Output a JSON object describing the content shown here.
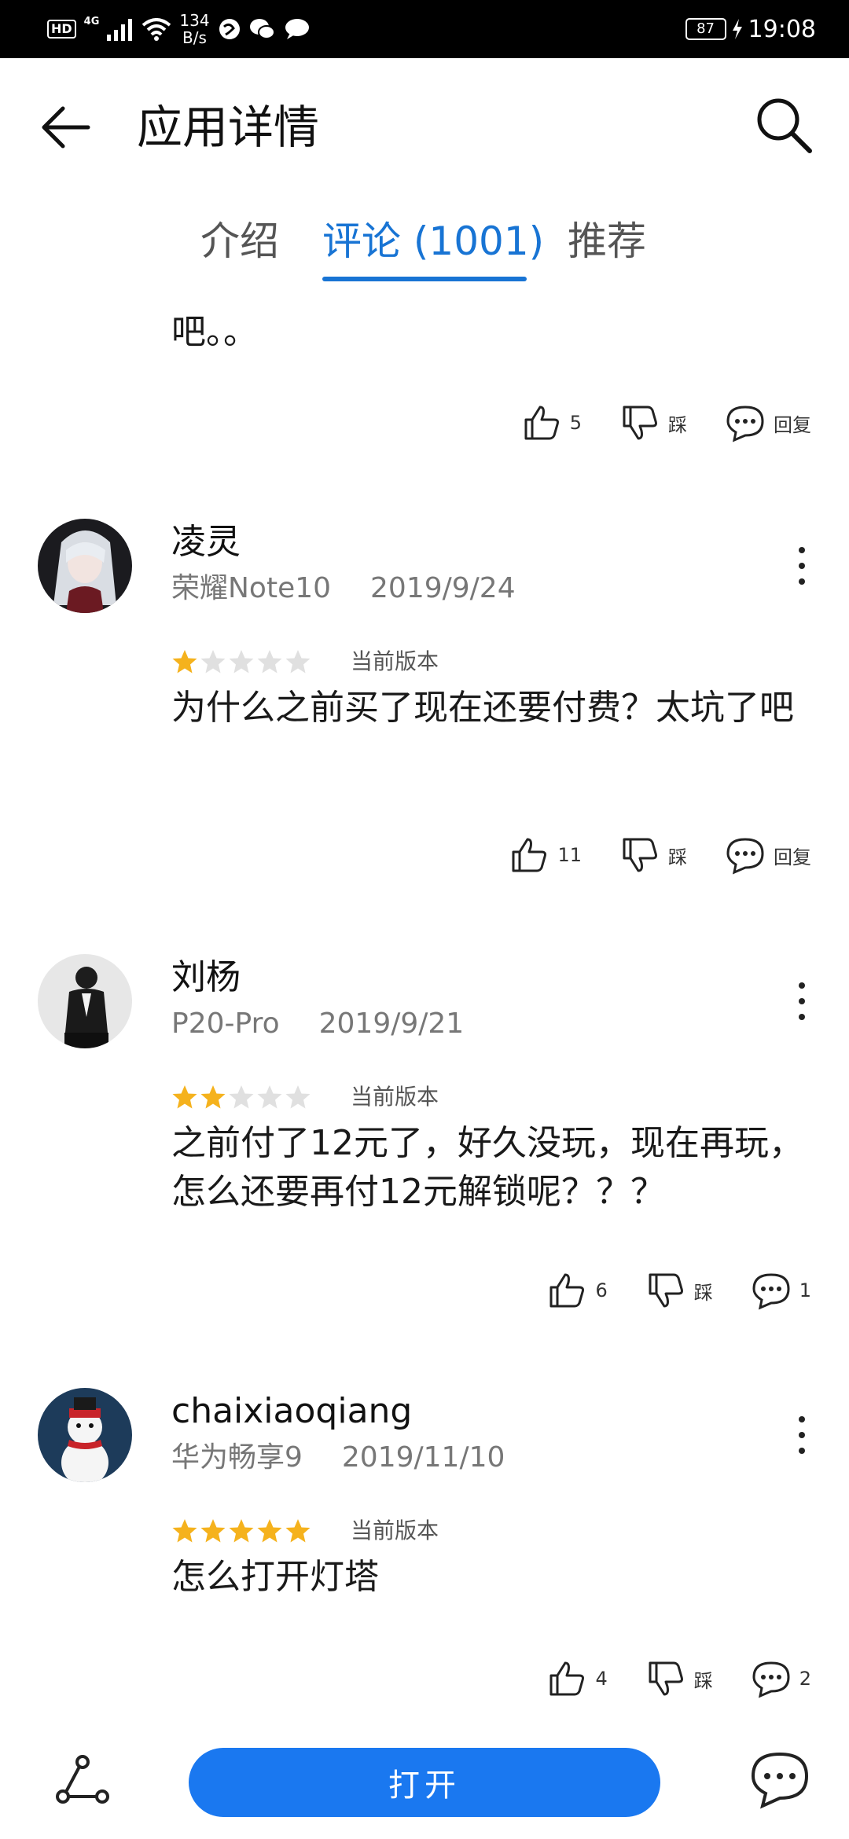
{
  "status_bar": {
    "hd": "HD",
    "network": "4G",
    "speed_value": "134",
    "speed_unit": "B/s",
    "battery": "87",
    "time": "19:08"
  },
  "header": {
    "title": "应用详情"
  },
  "tabs": [
    {
      "label": "介绍",
      "active": false
    },
    {
      "label": "评论 (1001)",
      "active": true
    },
    {
      "label": "推荐",
      "active": false
    }
  ],
  "partial_review": {
    "text": "吧。。",
    "likes": "5",
    "dislike_label": "踩",
    "reply_label": "回复"
  },
  "reviews": [
    {
      "name": "凌灵",
      "device": "荣耀Note10",
      "date": "2019/9/24",
      "rating": 1,
      "version_label": "当前版本",
      "text": "为什么之前买了现在还要付费？太坑了吧",
      "likes": "11",
      "dislike_label": "踩",
      "reply": "回复"
    },
    {
      "name": "刘杨",
      "device": "P20-Pro",
      "date": "2019/9/21",
      "rating": 2,
      "version_label": "当前版本",
      "text": "之前付了12元了，好久没玩，现在再玩，怎么还要再付12元解锁呢？？？",
      "likes": "6",
      "dislike_label": "踩",
      "reply": "1"
    },
    {
      "name": "chaixiaoqiang",
      "device": "华为畅享9",
      "date": "2019/11/10",
      "rating": 5,
      "version_label": "当前版本",
      "text": "怎么打开灯塔",
      "likes": "4",
      "dislike_label": "踩",
      "reply": "2"
    }
  ],
  "bottom_bar": {
    "open_label": "打开"
  },
  "colors": {
    "accent": "#1874d4",
    "open_button": "#1a78f0",
    "star_filled": "#f5b21d",
    "star_empty": "#e0e0e0"
  }
}
